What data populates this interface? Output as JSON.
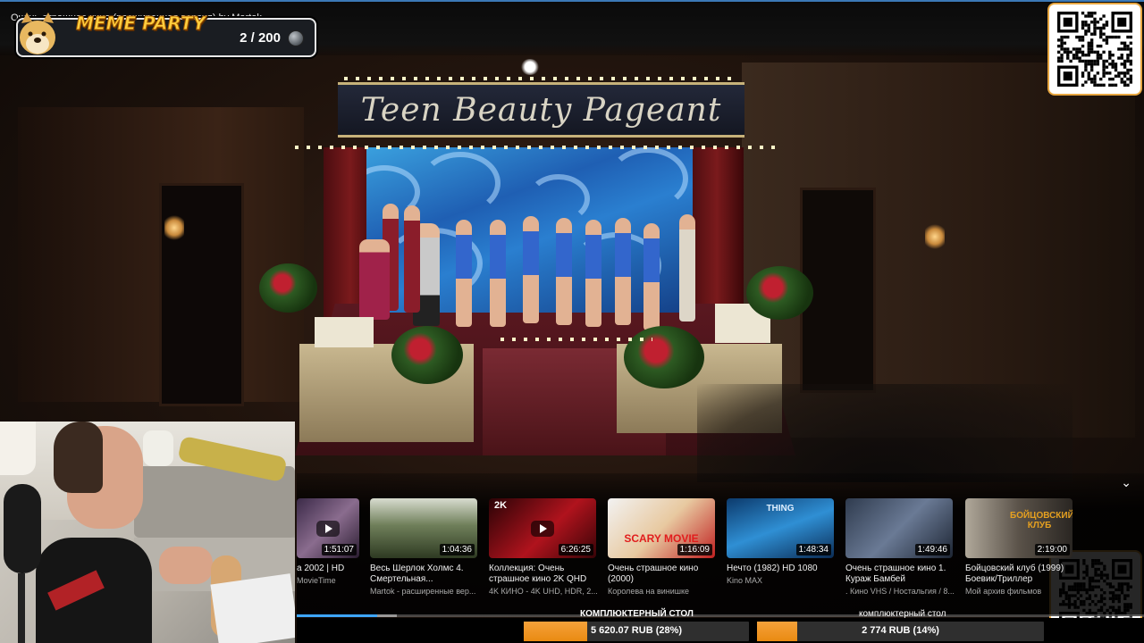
{
  "video": {
    "title": "Очень страшное кино (расширенная версия) by Martok",
    "banner": "Teen Beauty Pageant"
  },
  "meme_widget": {
    "title": "MEME PARTY",
    "count": "2 / 200",
    "progress_fraction": 0.01
  },
  "recommendations": {
    "items": [
      {
        "title": "a 2002 | HD",
        "channel": "MovieTime",
        "duration": "1:51:07",
        "thumb_text": ""
      },
      {
        "title": "Весь Шерлок Холмс 4. Смертельная...",
        "channel": "Martok - расширенные вер...",
        "duration": "1:04:36",
        "thumb_text": ""
      },
      {
        "title": "Коллекция: Очень страшное кино 2K QHD",
        "channel": "4K КИНО - 4K UHD, HDR, 2...",
        "duration": "6:26:25",
        "thumb_text": "2K"
      },
      {
        "title": "Очень страшное кино (2000)",
        "channel": "Королева на винишке",
        "duration": "1:16:09",
        "thumb_text": "SCARY MOVIE"
      },
      {
        "title": "Нечто (1982) HD 1080",
        "channel": "Kino MAX",
        "duration": "1:48:34",
        "thumb_text": "THING"
      },
      {
        "title": "Очень страшное кино 1. Кураж Бамбей",
        "channel": ". Кино VHS / Ностальгия / 8...",
        "duration": "1:49:46",
        "thumb_text": ""
      },
      {
        "title": "Бойцовский клуб (1999) Боевик/Триллер",
        "channel": "Мой архив фильмов",
        "duration": "2:19:00",
        "thumb_text": "БОЙЦОВСКИЙ КЛУБ"
      }
    ]
  },
  "playback": {
    "progress_fraction": 0.095,
    "buffer_fraction": 0.118
  },
  "goals": [
    {
      "label": "КОМПЛЮКТЕРНЫЙ СТОЛ",
      "text": "5 620.07 RUB (28%)",
      "fraction": 0.28
    },
    {
      "label": "комплюктерный стол",
      "text": "2 774 RUB (14%)",
      "fraction": 0.14
    }
  ],
  "colors": {
    "accent_orange": "#e98a12",
    "seek_blue": "#3ea6ff",
    "meme_yellow": "#ffcf3f"
  },
  "icons": [
    "doge-icon",
    "coin-icon",
    "qr-code-icon",
    "chevron-down-icon",
    "play-icon"
  ]
}
